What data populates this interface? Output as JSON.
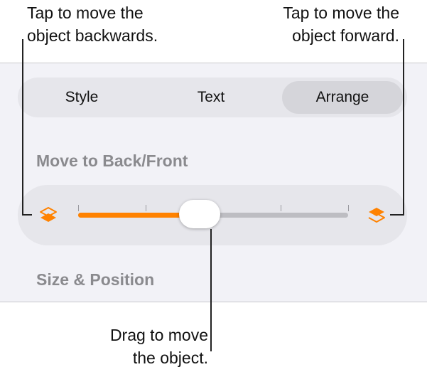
{
  "callouts": {
    "backward": [
      "Tap to move the",
      "object backwards."
    ],
    "forward": [
      "Tap to move the",
      "object forward."
    ],
    "drag": [
      "Drag to move",
      "the object."
    ]
  },
  "tabs": [
    {
      "label": "Style",
      "selected": false
    },
    {
      "label": "Text",
      "selected": false
    },
    {
      "label": "Arrange",
      "selected": true
    }
  ],
  "sections": {
    "move_label": "Move to Back/Front",
    "size_label": "Size & Position"
  },
  "slider": {
    "value_fraction": 0.45,
    "tick_count": 5,
    "accent_color": "#ff8200"
  },
  "icons": {
    "back": "layers-send-backward-icon",
    "front": "layers-bring-forward-icon"
  }
}
